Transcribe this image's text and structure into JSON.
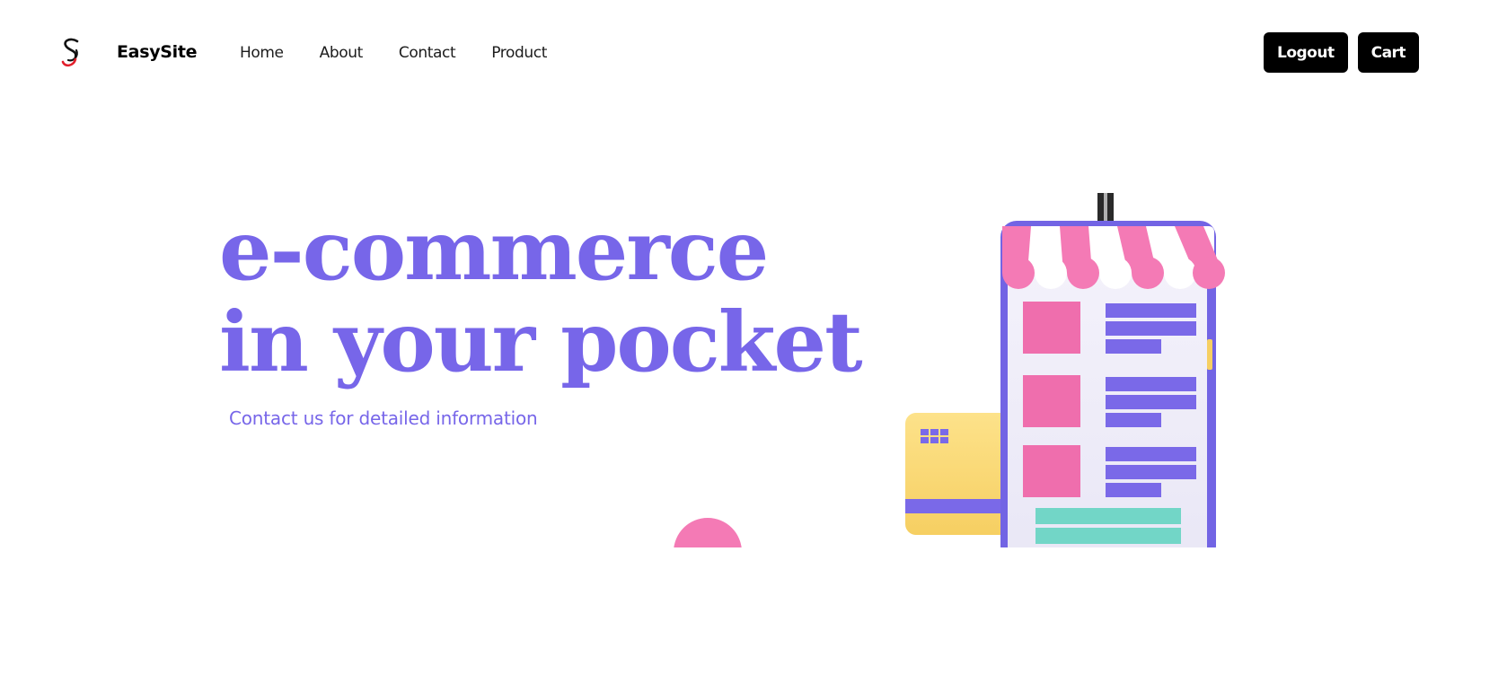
{
  "header": {
    "brand_name": "EasySite",
    "nav_links": [
      "Home",
      "About",
      "Contact",
      "Product"
    ],
    "logout_label": "Logout",
    "cart_label": "Cart"
  },
  "hero": {
    "title_line1": "e-commerce",
    "title_line2": "in your pocket",
    "subtitle": "Contact us for detailed information"
  },
  "colors": {
    "accent": "#7766e9",
    "pink": "#f47ab5",
    "button_bg": "#000000"
  },
  "icons": {
    "logo": "easysite-s-logo",
    "illustration": "mobile-shop-illustration"
  }
}
